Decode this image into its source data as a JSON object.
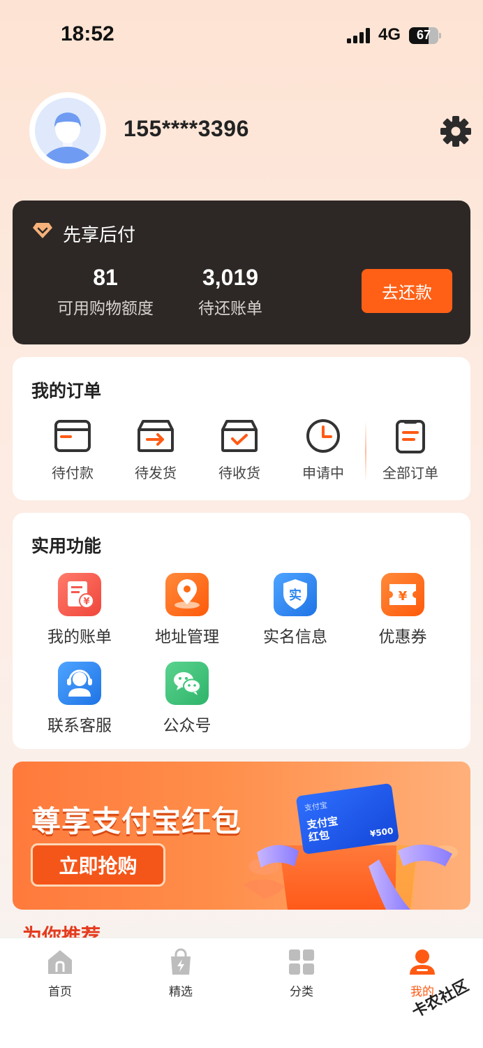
{
  "status_bar": {
    "time": "18:52",
    "network": "4G",
    "battery": "67",
    "battery_level": 0.67
  },
  "profile": {
    "phone": "155****3396"
  },
  "bnpl": {
    "title": "先享后付",
    "credit_value": "81",
    "credit_label": "可用购物额度",
    "bill_value": "3,019",
    "bill_label": "待还账单",
    "repay_button": "去还款"
  },
  "orders": {
    "heading": "我的订单",
    "items": [
      {
        "label": "待付款",
        "icon": "wallet-card-icon"
      },
      {
        "label": "待发货",
        "icon": "box-arrow-icon"
      },
      {
        "label": "待收货",
        "icon": "box-check-icon"
      },
      {
        "label": "申请中",
        "icon": "clock-icon"
      },
      {
        "label": "全部订单",
        "icon": "clipboard-list-icon"
      }
    ]
  },
  "tools": {
    "heading": "实用功能",
    "items": [
      {
        "label": "我的账单",
        "icon": "bill-icon",
        "color": "#f35a4e"
      },
      {
        "label": "地址管理",
        "icon": "location-pin-icon",
        "color": "#ff6b14"
      },
      {
        "label": "实名信息",
        "icon": "shield-id-icon",
        "icon_text": "实",
        "color": "#2e86f0"
      },
      {
        "label": "优惠券",
        "icon": "coupon-icon",
        "icon_text": "¥",
        "color": "#ff6b14"
      },
      {
        "label": "联系客服",
        "icon": "headset-icon",
        "color": "#2e86f0"
      },
      {
        "label": "公众号",
        "icon": "wechat-icon",
        "color": "#3ec67a"
      }
    ]
  },
  "banner": {
    "headline": "尊享支付宝红包",
    "button": "立即抢购",
    "card_brand": "支付宝",
    "card_title_1": "支付宝",
    "card_title_2": "红包",
    "card_amount": "¥500"
  },
  "recommend": {
    "heading": "为你推荐"
  },
  "tabbar": {
    "items": [
      {
        "label": "首页",
        "icon": "home-icon"
      },
      {
        "label": "精选",
        "icon": "shopping-bag-icon"
      },
      {
        "label": "分类",
        "icon": "grid-icon"
      },
      {
        "label": "我的",
        "icon": "user-icon"
      }
    ],
    "active": "我的"
  },
  "watermark": {
    "text": "卡农社区"
  },
  "colors": {
    "accent": "#ff6016",
    "dark_card": "#2d2826"
  }
}
